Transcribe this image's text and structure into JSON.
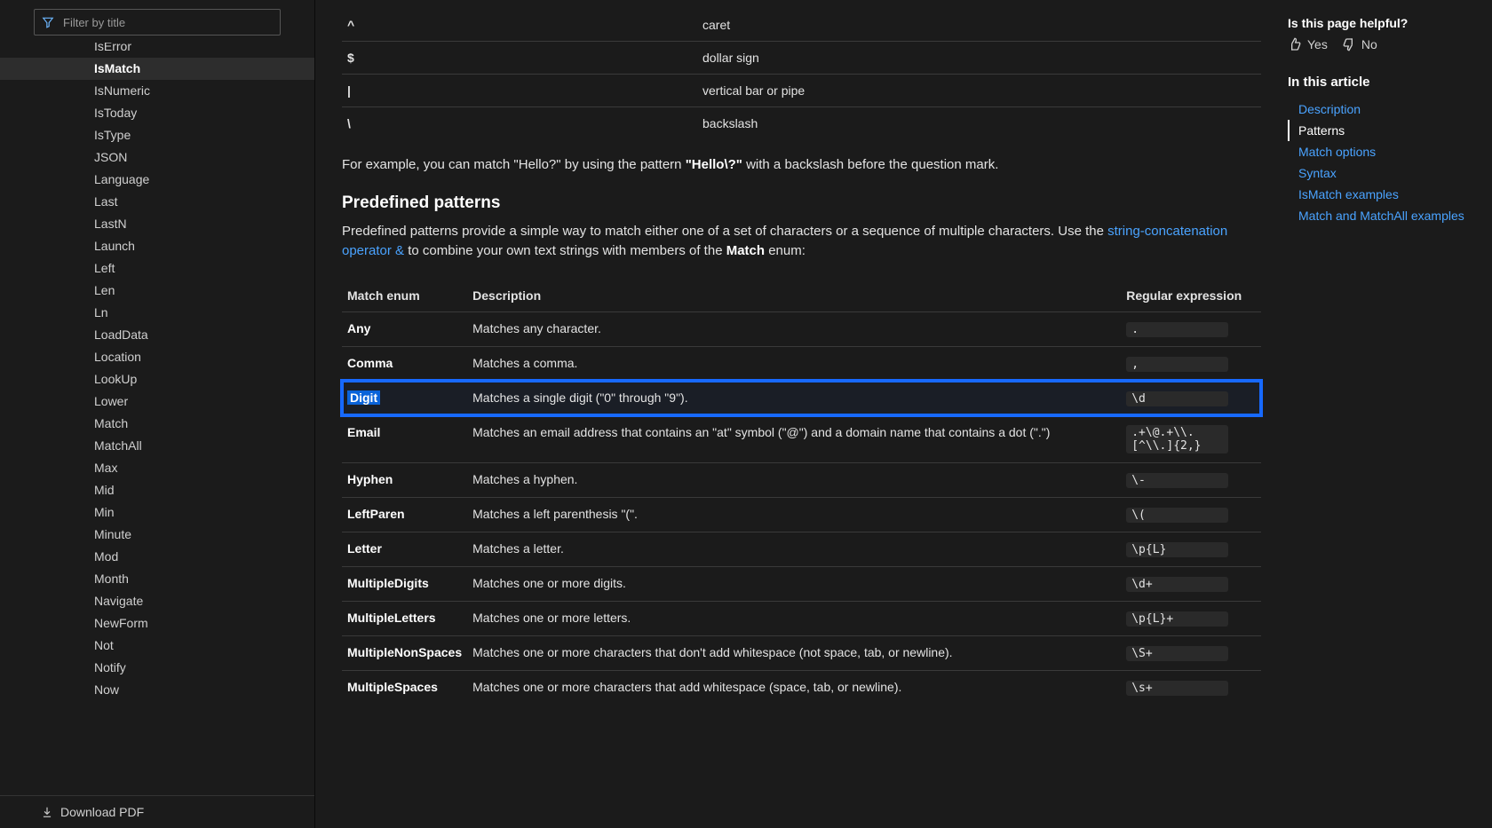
{
  "filter": {
    "placeholder": "Filter by title"
  },
  "nav": {
    "items": [
      "IsError",
      "IsMatch",
      "IsNumeric",
      "IsToday",
      "IsType",
      "JSON",
      "Language",
      "Last",
      "LastN",
      "Launch",
      "Left",
      "Len",
      "Ln",
      "LoadData",
      "Location",
      "LookUp",
      "Lower",
      "Match",
      "MatchAll",
      "Max",
      "Mid",
      "Min",
      "Minute",
      "Mod",
      "Month",
      "Navigate",
      "NewForm",
      "Not",
      "Notify",
      "Now"
    ],
    "selected": 1
  },
  "download": "Download PDF",
  "special_chars": [
    {
      "sym": "^",
      "name": "caret"
    },
    {
      "sym": "$",
      "name": "dollar sign"
    },
    {
      "sym": "|",
      "name": "vertical bar or pipe"
    },
    {
      "sym": "\\",
      "name": "backslash"
    }
  ],
  "example_para": {
    "pre": "For example, you can match \"Hello?\" by using the pattern ",
    "bold": "\"Hello\\?\"",
    "post": " with a backslash before the question mark."
  },
  "predefined_heading": "Predefined patterns",
  "predefined_para": {
    "pre": "Predefined patterns provide a simple way to match either one of a set of characters or a sequence of multiple characters. Use the ",
    "link": "string-concatenation operator &",
    "mid": " to combine your own text strings with members of the ",
    "bold": "Match",
    "post": " enum:"
  },
  "patterns": {
    "headers": [
      "Match enum",
      "Description",
      "Regular expression"
    ],
    "rows": [
      {
        "enum": "Any",
        "desc": "Matches any character.",
        "regex": "."
      },
      {
        "enum": "Comma",
        "desc": "Matches a comma.",
        "regex": ","
      },
      {
        "enum": "Digit",
        "desc": "Matches a single digit (\"0\" through \"9\").",
        "regex": "\\d",
        "highlight": true
      },
      {
        "enum": "Email",
        "desc": "Matches an email address that contains an \"at\" symbol (\"@\") and a domain name that contains a dot (\".\")",
        "regex": ".+\\@.+\\\\.[^\\\\.]{2,}"
      },
      {
        "enum": "Hyphen",
        "desc": "Matches a hyphen.",
        "regex": "\\-"
      },
      {
        "enum": "LeftParen",
        "desc": "Matches a left parenthesis \"(\".",
        "regex": "\\("
      },
      {
        "enum": "Letter",
        "desc": "Matches a letter.",
        "regex": "\\p{L}"
      },
      {
        "enum": "MultipleDigits",
        "desc": "Matches one or more digits.",
        "regex": "\\d+"
      },
      {
        "enum": "MultipleLetters",
        "desc": "Matches one or more letters.",
        "regex": "\\p{L}+"
      },
      {
        "enum": "MultipleNonSpaces",
        "desc": "Matches one or more characters that don't add whitespace (not space, tab, or newline).",
        "regex": "\\S+"
      },
      {
        "enum": "MultipleSpaces",
        "desc": "Matches one or more characters that add whitespace (space, tab, or newline).",
        "regex": "\\s+"
      }
    ]
  },
  "helpful": {
    "title": "Is this page helpful?",
    "yes": "Yes",
    "no": "No"
  },
  "toc": {
    "title": "In this article",
    "items": [
      {
        "label": "Description",
        "active": false
      },
      {
        "label": "Patterns",
        "active": true
      },
      {
        "label": "Match options",
        "active": false
      },
      {
        "label": "Syntax",
        "active": false
      },
      {
        "label": "IsMatch examples",
        "active": false
      },
      {
        "label": "Match and MatchAll examples",
        "active": false
      }
    ]
  }
}
